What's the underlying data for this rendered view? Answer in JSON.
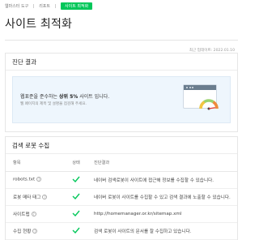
{
  "breadcrumb": {
    "items": [
      "웹마스터 도구",
      "리포트",
      "사이트 최적화"
    ]
  },
  "page_title": "사이트 최적화",
  "timestamp": "최근 업데이트: 2022.01.10",
  "diagnosis": {
    "title": "진단 결과",
    "message_prefix": "웹표준을 준수하는 ",
    "message_highlight": "상위 5%",
    "message_suffix": " 사이트 입니다.",
    "sub_message": "웹 페이지의 제목 및 설명을 점검해 주세요.",
    "gauge_level_percent": 95
  },
  "crawl": {
    "title": "검색 로봇 수집",
    "columns": {
      "item": "항목",
      "status": "상태",
      "result": "진단결과"
    },
    "rows": [
      {
        "item": "robots.txt",
        "status": "pass",
        "result": "네이버 검색로봇이 사이트에 접근해 정보를 수집할 수 있습니다."
      },
      {
        "item": "로봇 메타 태그",
        "status": "pass",
        "result": "네이버 로봇이 사이트를 수집할 수 있고 검색 결과에 노출할 수 있습니다."
      },
      {
        "item": "사이트맵",
        "status": "pass",
        "result": "http://homemanager.or.kr/sitemap.xml"
      },
      {
        "item": "수집 현황",
        "status": "pass",
        "result": "검색 로봇이 사이트의 문서를 잘 수집하고 있습니다."
      }
    ]
  },
  "colors": {
    "accent": "#03c75a",
    "result_bg": "#eef6fd",
    "gauge_needle": "#e53935"
  }
}
